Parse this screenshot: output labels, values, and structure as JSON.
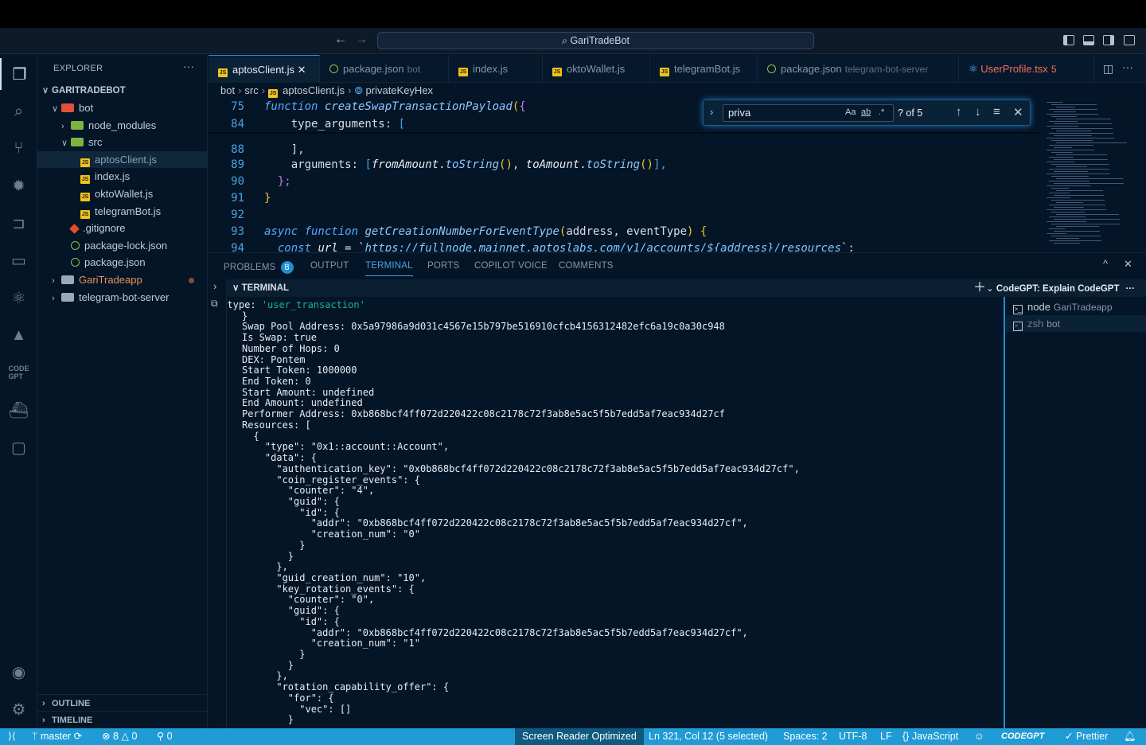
{
  "window": {
    "title": "GariTradeBot"
  },
  "activity_bar": {
    "items": [
      "explorer",
      "search",
      "source-control",
      "run-debug",
      "remote-explorer",
      "remote-display",
      "react",
      "aptos",
      "codegpt",
      "docker",
      "chat"
    ],
    "accounts_badge": "1",
    "accent": "#1f9bd5"
  },
  "explorer": {
    "title": "EXPLORER",
    "root": "GARITRADEBOT",
    "tree": [
      {
        "label": "bot",
        "icon": "folder-bot",
        "chevron": "down",
        "indent": 1
      },
      {
        "label": "node_modules",
        "icon": "folder-node",
        "chevron": "right",
        "indent": 2
      },
      {
        "label": "src",
        "icon": "folder-src",
        "chevron": "down",
        "indent": 2
      },
      {
        "label": "aptosClient.js",
        "icon": "js",
        "indent": 3,
        "selected": true
      },
      {
        "label": "index.js",
        "icon": "js",
        "indent": 3
      },
      {
        "label": "oktoWallet.js",
        "icon": "js",
        "indent": 3
      },
      {
        "label": "telegramBot.js",
        "icon": "js",
        "indent": 3
      },
      {
        "label": ".gitignore",
        "icon": "git",
        "indent": 2
      },
      {
        "label": "package-lock.json",
        "icon": "npm",
        "indent": 2
      },
      {
        "label": "package.json",
        "icon": "npm",
        "indent": 2
      },
      {
        "label": "GariTradeapp",
        "icon": "folder",
        "chevron": "right",
        "indent": 1,
        "modified": true
      },
      {
        "label": "telegram-bot-server",
        "icon": "folder",
        "chevron": "right",
        "indent": 1
      }
    ],
    "outline": "OUTLINE",
    "timeline": "TIMELINE"
  },
  "tabs": [
    {
      "label": "aptosClient.js",
      "icon": "js",
      "active": true
    },
    {
      "label": "package.json",
      "desc": "bot",
      "icon": "npm"
    },
    {
      "label": "index.js",
      "icon": "js"
    },
    {
      "label": "oktoWallet.js",
      "icon": "js"
    },
    {
      "label": "telegramBot.js",
      "icon": "js"
    },
    {
      "label": "package.json",
      "desc": "telegram-bot-server",
      "icon": "npm"
    },
    {
      "label": "UserProfile.tsx",
      "desc": "5",
      "icon": "react",
      "error": true
    }
  ],
  "breadcrumb": [
    "bot",
    "src",
    "aptosClient.js",
    "privateKeyHex"
  ],
  "code": [
    {
      "n": "75",
      "tokens": [
        [
          "function ",
          "k"
        ],
        [
          "createSwapTransactionPayload",
          "f"
        ],
        [
          "(",
          "b"
        ],
        [
          "{",
          "br2"
        ]
      ]
    },
    {
      "n": "84",
      "tokens": [
        [
          "    type_arguments: ",
          "p"
        ],
        [
          "[",
          "b3"
        ]
      ]
    },
    {
      "n": "88",
      "tokens": [
        [
          "    ],",
          "p"
        ]
      ]
    },
    {
      "n": "89",
      "tokens": [
        [
          "    arguments: ",
          "p"
        ],
        [
          "[",
          "b3"
        ],
        [
          "fromAmount",
          "v"
        ],
        [
          ".",
          "p"
        ],
        [
          "toString",
          "m"
        ],
        [
          "()",
          "b"
        ],
        [
          ", ",
          "p"
        ],
        [
          "toAmount",
          "v"
        ],
        [
          ".",
          "p"
        ],
        [
          "toString",
          "m"
        ],
        [
          "()",
          "b"
        ],
        [
          "],",
          "b3"
        ]
      ]
    },
    {
      "n": "90",
      "tokens": [
        [
          "  };",
          "br2"
        ]
      ]
    },
    {
      "n": "91",
      "tokens": [
        [
          "}",
          "b"
        ]
      ]
    },
    {
      "n": "92",
      "tokens": []
    },
    {
      "n": "93",
      "tokens": [
        [
          "async ",
          "k"
        ],
        [
          "function ",
          "k"
        ],
        [
          "getCreationNumberForEventType",
          "f"
        ],
        [
          "(",
          "b"
        ],
        [
          "address, eventType",
          "p"
        ],
        [
          ") ",
          "b"
        ],
        [
          "{",
          "b"
        ]
      ]
    },
    {
      "n": "94",
      "tokens": [
        [
          "  const ",
          "k"
        ],
        [
          "url ",
          "v"
        ],
        [
          "= `",
          "p"
        ],
        [
          "https://fullnode.mainnet.aptoslabs.com/v1/accounts/${address}/resources",
          "s"
        ],
        [
          "`;",
          "p"
        ]
      ]
    }
  ],
  "find": {
    "value": "priva",
    "match_case": "Aa",
    "whole_word": "ab",
    "regex": ".*",
    "result": "? of 5"
  },
  "panel": {
    "tabs": [
      {
        "label": "PROBLEMS",
        "badge": "8"
      },
      {
        "label": "OUTPUT"
      },
      {
        "label": "TERMINAL",
        "active": true
      },
      {
        "label": "PORTS"
      },
      {
        "label": "COPILOT VOICE"
      },
      {
        "label": "COMMENTS"
      }
    ],
    "terminal_header": "TERMINAL",
    "terminal_first": {
      "prefix": "  type: ",
      "string": "'user_transaction'"
    },
    "terminal_lines": [
      "}",
      "Swap Pool Address: 0x5a97986a9d031c4567e15b797be516910cfcb4156312482efc6a19c0a30c948",
      "Is Swap: true",
      "Number of Hops: 0",
      "DEX: Pontem",
      "Start Token: 1000000",
      "End Token: 0",
      "Start Amount: undefined",
      "End Amount: undefined",
      "Performer Address: 0xb868bcf4ff072d220422c08c2178c72f3ab8e5ac5f5b7edd5af7eac934d27cf",
      "Resources: [",
      "  {",
      "    \"type\": \"0x1::account::Account\",",
      "    \"data\": {",
      "      \"authentication_key\": \"0x0b868bcf4ff072d220422c08c2178c72f3ab8e5ac5f5b7edd5af7eac934d27cf\",",
      "      \"coin_register_events\": {",
      "        \"counter\": \"4\",",
      "        \"guid\": {",
      "          \"id\": {",
      "            \"addr\": \"0xb868bcf4ff072d220422c08c2178c72f3ab8e5ac5f5b7edd5af7eac934d27cf\",",
      "            \"creation_num\": \"0\"",
      "          }",
      "        }",
      "      },",
      "      \"guid_creation_num\": \"10\",",
      "      \"key_rotation_events\": {",
      "        \"counter\": \"0\",",
      "        \"guid\": {",
      "          \"id\": {",
      "            \"addr\": \"0xb868bcf4ff072d220422c08c2178c72f3ab8e5ac5f5b7edd5af7eac934d27cf\",",
      "            \"creation_num\": \"1\"",
      "          }",
      "        }",
      "      },",
      "      \"rotation_capability_offer\": {",
      "        \"for\": {",
      "          \"vec\": []",
      "        }"
    ],
    "terminal_list_title": "CodeGPT: Explain CodeGPT",
    "terminals": [
      {
        "name": "node",
        "desc": "GariTradeapp",
        "active": true
      },
      {
        "name": "zsh",
        "desc": "bot"
      }
    ]
  },
  "statusbar": {
    "branch": "master",
    "errors": "8",
    "warnings": "0",
    "ports": "0",
    "screen_reader": "Screen Reader Optimized",
    "cursor": "Ln 321, Col 12 (5 selected)",
    "spaces": "Spaces: 2",
    "encoding": "UTF-8",
    "eol": "LF",
    "language": "JavaScript",
    "codegpt": "CODEGPT",
    "prettier": "Prettier"
  }
}
